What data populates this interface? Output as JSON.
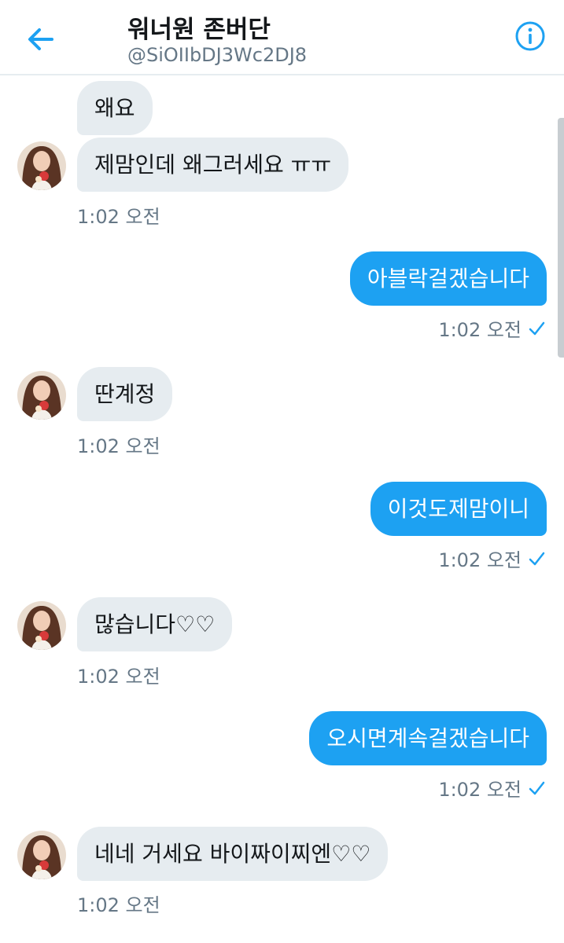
{
  "header": {
    "title": "워너원 존버단",
    "handle": "@SiOIIbDJ3Wc2DJ8"
  },
  "colors": {
    "accent": "#1da1f2",
    "incoming_bubble": "#e6ecf0",
    "meta_text": "#657786"
  },
  "icons": {
    "back": "back-arrow-icon",
    "info": "info-icon",
    "read": "checkmark-icon"
  },
  "messages": [
    {
      "side": "in",
      "text": "왜요"
    },
    {
      "side": "in",
      "text": "제맘인데 왜그러세요 ㅠㅠ",
      "time": "1:02 오전"
    },
    {
      "side": "out",
      "text": "아블락걸겠습니다",
      "time": "1:02 오전"
    },
    {
      "side": "in",
      "text": "딴계정",
      "time": "1:02 오전"
    },
    {
      "side": "out",
      "text": "이것도제맘이니",
      "time": "1:02 오전"
    },
    {
      "side": "in",
      "text": "많습니다♡♡",
      "time": "1:02 오전"
    },
    {
      "side": "out",
      "text": "오시면계속걸겠습니다",
      "time": "1:02 오전"
    },
    {
      "side": "in",
      "text": "네네 거세요 바이짜이찌엔♡♡",
      "time": "1:02 오전"
    }
  ]
}
